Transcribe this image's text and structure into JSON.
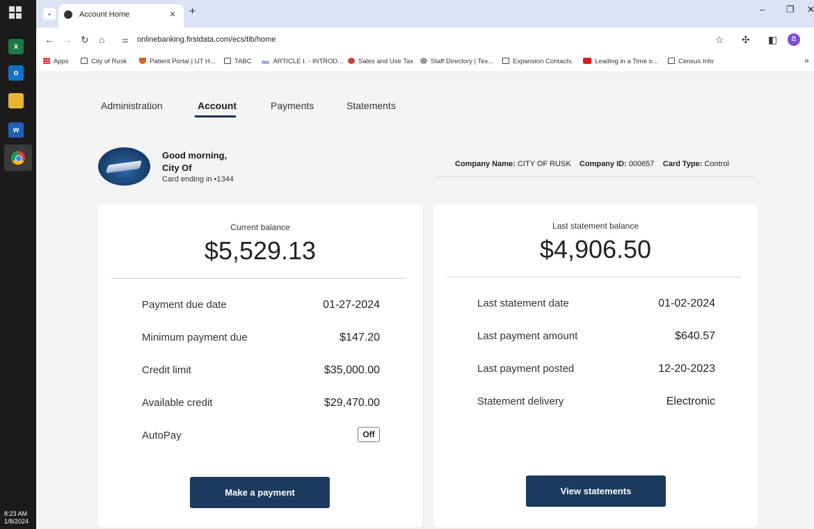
{
  "taskbar": {
    "clock_time": "8:23 AM",
    "clock_date": "1/8/2024"
  },
  "browser": {
    "tab_title": "Account Home",
    "tab_close": "×",
    "new_tab": "+",
    "url": "onlinebanking.firstdata.com/ecs/tib/home",
    "bookmarks": [
      {
        "label": "Apps",
        "icon": "grid-icon"
      },
      {
        "label": "City of Rusk",
        "icon": "folder-icon"
      },
      {
        "label": "Patient Portal | UT H...",
        "icon": "shield-icon"
      },
      {
        "label": "TABC",
        "icon": "folder-icon"
      },
      {
        "label": "ARTICLE I. - INTROD...",
        "icon": "mc-icon"
      },
      {
        "label": "Sales and Use Tax",
        "icon": "seal-icon"
      },
      {
        "label": "Staff Directory | Tex...",
        "icon": "globe-icon"
      },
      {
        "label": "Expansion Contacts.",
        "icon": "folder-icon"
      },
      {
        "label": "Leading in a Time o...",
        "icon": "youtube-icon"
      },
      {
        "label": "Census Info",
        "icon": "folder-icon"
      }
    ],
    "bookmarks_more": "»",
    "profile_initial": "B"
  },
  "nav": {
    "tabs": [
      {
        "label": "Administration",
        "active": false
      },
      {
        "label": "Account",
        "active": true
      },
      {
        "label": "Payments",
        "active": false
      },
      {
        "label": "Statements",
        "active": false
      }
    ]
  },
  "greeting": {
    "line1": "Good morning,",
    "line2": "City Of",
    "card_ending": "Card ending in •1344"
  },
  "company": {
    "name_label": "Company Name:",
    "name_value": "CITY OF RUSK",
    "id_label": "Company ID:",
    "id_value": "000657",
    "card_type_label": "Card Type:",
    "card_type_value": "Control"
  },
  "current": {
    "label": "Current balance",
    "value": "$5,529.13",
    "rows": [
      {
        "label": "Payment due date",
        "value": "01-27-2024"
      },
      {
        "label": "Minimum payment due",
        "value": "$147.20"
      },
      {
        "label": "Credit limit",
        "value": "$35,000.00"
      },
      {
        "label": "Available credit",
        "value": "$29,470.00"
      }
    ],
    "autopay_label": "AutoPay",
    "autopay_value": "Off",
    "button": "Make a payment"
  },
  "statement": {
    "label": "Last statement balance",
    "value": "$4,906.50",
    "rows": [
      {
        "label": "Last statement date",
        "value": "01-02-2024"
      },
      {
        "label": "Last payment amount",
        "value": "$640.57"
      },
      {
        "label": "Last payment posted",
        "value": "12-20-2023"
      },
      {
        "label": "Statement delivery",
        "value": "Electronic"
      }
    ],
    "button": "View statements"
  },
  "colors": {
    "accent_navy": "#1b3a5e",
    "tab_underline": "#1b2f55",
    "tabbar_bg": "#dbe4f5"
  }
}
